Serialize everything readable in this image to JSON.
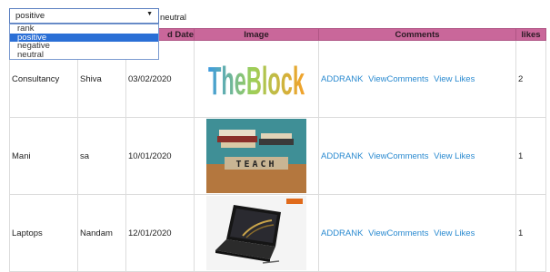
{
  "filter": {
    "selected": "positive",
    "label": "neutral",
    "options": [
      "rank",
      "positive",
      "negative",
      "neutral"
    ]
  },
  "table": {
    "headers": [
      "",
      "",
      "d Date",
      "Image",
      "Comments",
      "likes"
    ],
    "rows": [
      {
        "name": "Consultancy",
        "user": "Shiva",
        "date": "03/02/2020",
        "image": "theblock-logo",
        "image_text": "TheBlock",
        "actions": [
          "ADDRANK",
          "ViewComments",
          "View Likes"
        ],
        "likes": "2"
      },
      {
        "name": "Mani",
        "user": "sa",
        "date": "10/01/2020",
        "image": "teach-blocks-photo",
        "image_text": "TEACH",
        "actions": [
          "ADDRANK",
          "ViewComments",
          "View Likes"
        ],
        "likes": "1"
      },
      {
        "name": "Laptops",
        "user": "Nandam",
        "date": "12/01/2020",
        "image": "laptop-photo",
        "actions": [
          "ADDRANK",
          "ViewComments",
          "View Likes"
        ],
        "likes": "1"
      }
    ]
  },
  "colors": {
    "header_bg": "#c9679a",
    "link": "#2a8ad0",
    "selected_option": "#2a6fd6"
  }
}
